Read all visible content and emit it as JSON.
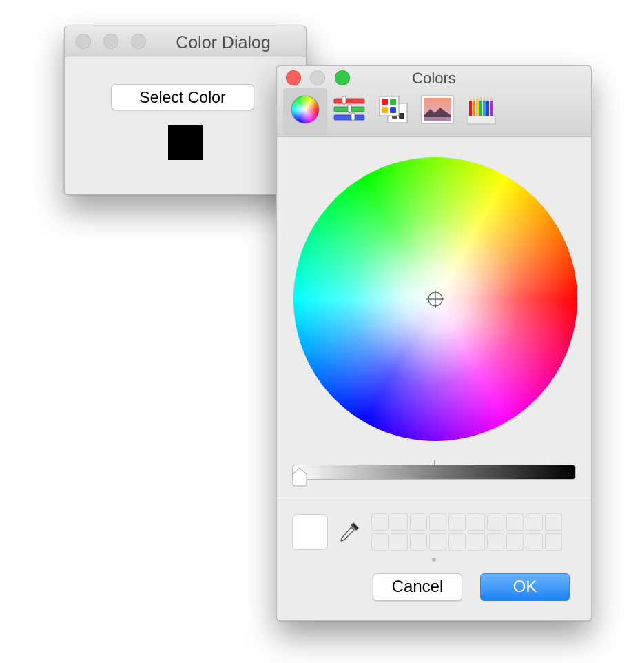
{
  "back_window": {
    "title": "Color Dialog",
    "select_button_label": "Select Color",
    "swatch_color": "#000000"
  },
  "color_panel": {
    "title": "Colors",
    "toolbar": [
      {
        "icon": "color-wheel-icon",
        "selected": true
      },
      {
        "icon": "color-sliders-icon",
        "selected": false
      },
      {
        "icon": "color-palettes-icon",
        "selected": false
      },
      {
        "icon": "image-palettes-icon",
        "selected": false
      },
      {
        "icon": "pencils-icon",
        "selected": false
      }
    ],
    "brightness_level": 0,
    "current_color": "#ffffff",
    "cancel_label": "Cancel",
    "ok_label": "OK",
    "accent_color": "#1d83f7"
  }
}
